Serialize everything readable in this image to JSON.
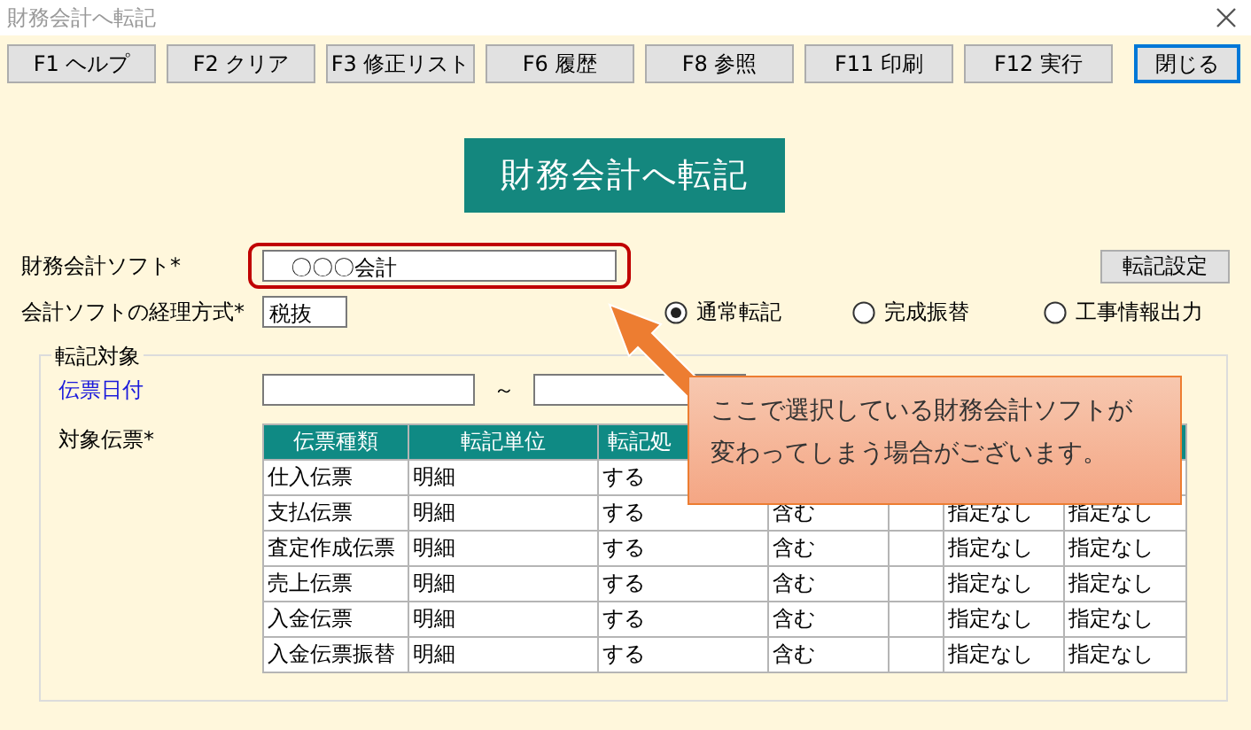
{
  "window": {
    "title": "財務会計へ転記"
  },
  "toolbar": {
    "buttons": [
      {
        "label": "F1 ヘルプ",
        "focused": false
      },
      {
        "label": "F2 クリア",
        "focused": false
      },
      {
        "label": "F3 修正リスト",
        "focused": false
      },
      {
        "label": "F6 履歴",
        "focused": false
      },
      {
        "label": "F8 参照",
        "focused": false
      },
      {
        "label": "F11 印刷",
        "focused": false
      },
      {
        "label": "F12 実行",
        "focused": false
      },
      {
        "label": "閉じる",
        "focused": true
      }
    ]
  },
  "heading": "財務会計へ転記",
  "software": {
    "label": "財務会計ソフト*",
    "value": "　〇〇〇会計",
    "highlighted": true
  },
  "settings_button": "転記設定",
  "tax_method": {
    "label": "会計ソフトの経理方式*",
    "value": "税抜"
  },
  "modes": [
    {
      "label": "通常転記",
      "selected": true
    },
    {
      "label": "完成振替",
      "selected": false
    },
    {
      "label": "工事情報出力",
      "selected": false
    }
  ],
  "group": {
    "title": "転記対象",
    "date_label": "伝票日付",
    "date_separator": "～",
    "slips_label": "対象伝票*",
    "table": {
      "columns": [
        "伝票種類",
        "転記単位",
        "転記処"
      ],
      "rows": [
        {
          "cells": [
            "仕入伝票",
            "明細",
            "する"
          ]
        },
        {
          "cells": [
            "支払伝票",
            "明細",
            "する",
            "含む",
            null,
            "指定なし",
            "指定なし"
          ]
        },
        {
          "cells": [
            "査定作成伝票",
            "明細",
            "する",
            "含む",
            null,
            "指定なし",
            "指定なし"
          ]
        },
        {
          "cells": [
            "売上伝票",
            "明細",
            "する",
            "含む",
            null,
            "指定なし",
            "指定なし"
          ]
        },
        {
          "cells": [
            "入金伝票",
            "明細",
            "する",
            "含む",
            null,
            "指定なし",
            "指定なし"
          ]
        },
        {
          "cells": [
            "入金伝票振替",
            "明細",
            "する",
            "含む",
            null,
            "指定なし",
            "指定なし"
          ]
        }
      ]
    }
  },
  "callout": {
    "lines": [
      "ここで選択している財務会計ソフトが",
      "変わってしまう場合がございます。"
    ]
  }
}
